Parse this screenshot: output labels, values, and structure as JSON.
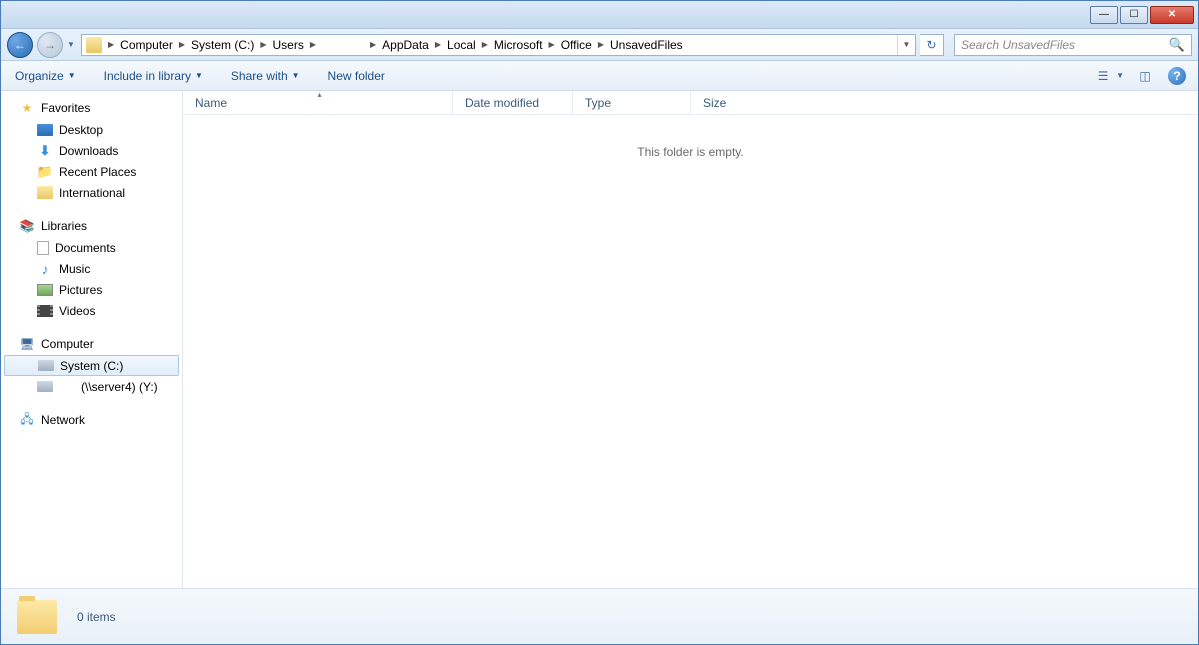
{
  "titlebar": {},
  "breadcrumb": {
    "segments": [
      "Computer",
      "System (C:)",
      "Users",
      "",
      "AppData",
      "Local",
      "Microsoft",
      "Office",
      "UnsavedFiles"
    ]
  },
  "search": {
    "placeholder": "Search UnsavedFiles"
  },
  "toolbar": {
    "organize": "Organize",
    "include": "Include in library",
    "share": "Share with",
    "newfolder": "New folder"
  },
  "columns": {
    "name": "Name",
    "date": "Date modified",
    "type": "Type",
    "size": "Size"
  },
  "content": {
    "empty_message": "This folder is empty."
  },
  "navpane": {
    "favorites": {
      "label": "Favorites",
      "items": [
        {
          "label": "Desktop",
          "icon": "desktop"
        },
        {
          "label": "Downloads",
          "icon": "download"
        },
        {
          "label": "Recent Places",
          "icon": "recent"
        },
        {
          "label": "International",
          "icon": "folder"
        }
      ]
    },
    "libraries": {
      "label": "Libraries",
      "items": [
        {
          "label": "Documents",
          "icon": "doc"
        },
        {
          "label": "Music",
          "icon": "music"
        },
        {
          "label": "Pictures",
          "icon": "pic"
        },
        {
          "label": "Videos",
          "icon": "vid"
        }
      ]
    },
    "computer": {
      "label": "Computer",
      "items": [
        {
          "label": "System (C:)",
          "icon": "drive",
          "selected": true
        },
        {
          "label": "(\\\\server4) (Y:)",
          "icon": "netdrive"
        }
      ]
    },
    "network": {
      "label": "Network"
    }
  },
  "status": {
    "items_text": "0 items"
  }
}
